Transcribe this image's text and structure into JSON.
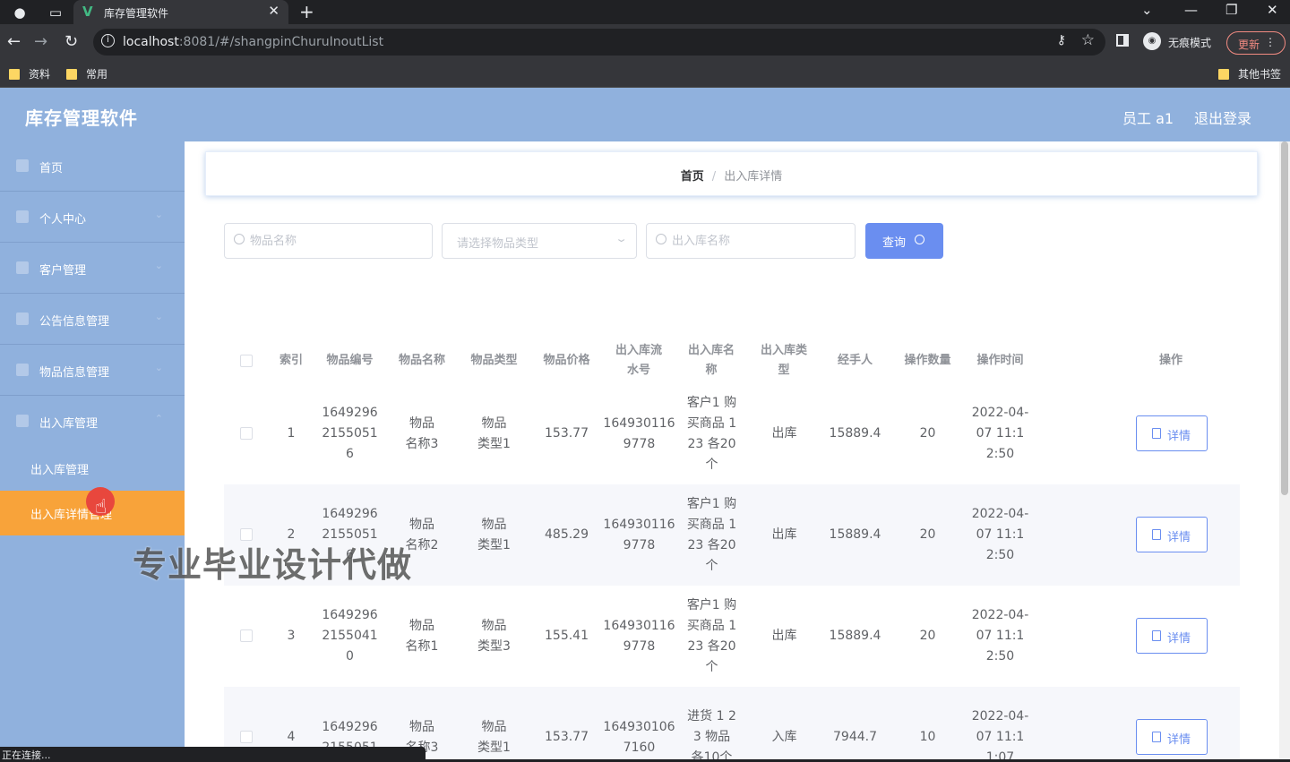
{
  "browser": {
    "tab_title": "库存管理软件",
    "url_host": "localhost",
    "url_rest": ":8081/#/shangpinChuruInoutList",
    "incognito_label": "无痕模式",
    "update_label": "更新",
    "bookmarks": [
      "资料",
      "常用"
    ],
    "other_bookmarks": "其他书签",
    "status_text": "正在连接..."
  },
  "header": {
    "title": "库存管理软件",
    "user": "员工 a1",
    "logout": "退出登录"
  },
  "sidebar": {
    "items": [
      {
        "label": "首页"
      },
      {
        "label": "个人中心"
      },
      {
        "label": "客户管理"
      },
      {
        "label": "公告信息管理"
      },
      {
        "label": "物品信息管理"
      },
      {
        "label": "出入库管理"
      }
    ],
    "sub_items": [
      {
        "label": "出入库管理"
      },
      {
        "label": "出入库详情管理"
      }
    ]
  },
  "breadcrumb": {
    "home": "首页",
    "separator": "/",
    "current": "出入库详情"
  },
  "search": {
    "name_placeholder": "物品名称",
    "type_placeholder": "请选择物品类型",
    "inout_placeholder": "出入库名称",
    "query_label": "查询"
  },
  "table": {
    "headers": {
      "index": "索引",
      "code": "物品编号",
      "name": "物品名称",
      "type": "物品类型",
      "price": "物品价格",
      "serial": "出入库流水号",
      "inout_name": "出入库名称",
      "inout_type": "出入库类型",
      "handler": "经手人",
      "qty": "操作数量",
      "time": "操作时间",
      "op": "操作"
    },
    "rows": [
      {
        "index": "1",
        "code": "16492962155051 6",
        "name": "物品名称3",
        "type": "物品类型1",
        "price": "153.77",
        "serial": "1649301169778",
        "inout_name": "客户1 购买商品 123 各20个",
        "inout_type": "出库",
        "handler": "15889.4",
        "qty": "20",
        "time": "2022-04-07 11:12:50",
        "op": "详情"
      },
      {
        "index": "2",
        "code": "16492962155051 6",
        "name": "物品名称2",
        "type": "物品类型1",
        "price": "485.29",
        "serial": "1649301169778",
        "inout_name": "客户1 购买商品 123 各20个",
        "inout_type": "出库",
        "handler": "15889.4",
        "qty": "20",
        "time": "2022-04-07 11:12:50",
        "op": "详情"
      },
      {
        "index": "3",
        "code": "16492962155041 0",
        "name": "物品名称1",
        "type": "物品类型3",
        "price": "155.41",
        "serial": "1649301169778",
        "inout_name": "客户1 购买商品 123 各20个",
        "inout_type": "出库",
        "handler": "15889.4",
        "qty": "20",
        "time": "2022-04-07 11:12:50",
        "op": "详情"
      },
      {
        "index": "4",
        "code": "16492962155051",
        "name": "物品名称3",
        "type": "物品类型1",
        "price": "153.77",
        "serial": "1649301067160",
        "inout_name": "进货 1 23 物品 各10个",
        "inout_type": "入库",
        "handler": "7944.7",
        "qty": "10",
        "time": "2022-04-07 11:11:07",
        "op": "详情"
      }
    ]
  },
  "watermark": "专业毕业设计代做",
  "colors": {
    "header_bg": "#90b1dd",
    "active_menu": "#f8a33a",
    "primary": "#6a8ef0"
  }
}
